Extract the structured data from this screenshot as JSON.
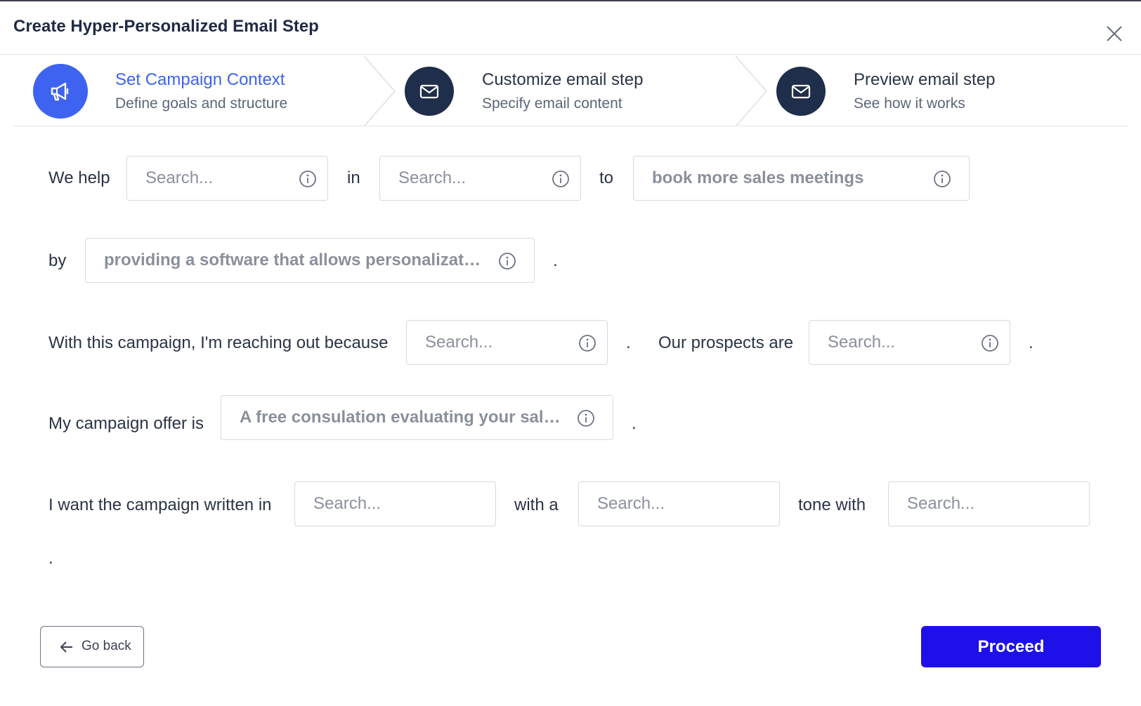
{
  "modal": {
    "title": "Create Hyper-Personalized Email Step"
  },
  "steps": [
    {
      "title": "Set Campaign Context",
      "subtitle": "Define goals and structure",
      "icon": "megaphone-icon",
      "color": "#3e63f0",
      "active": true
    },
    {
      "title": "Customize email step",
      "subtitle": "Specify email content",
      "icon": "envelope-icon",
      "color": "#1f2e4a",
      "active": false
    },
    {
      "title": "Preview email step",
      "subtitle": "See how it works",
      "icon": "envelope-icon",
      "color": "#1f2e4a",
      "active": false
    }
  ],
  "form": {
    "row1": {
      "we_help": "We help",
      "in": "in",
      "to": "to",
      "who_placeholder": "Search...",
      "industry_placeholder": "Search...",
      "goal_value": "book more sales meetings"
    },
    "row2": {
      "by": "by",
      "method_value": "providing a software that allows personalizati…",
      "period": "."
    },
    "row3": {
      "reaching_out": "With this campaign, I'm reaching out because",
      "reason_placeholder": "Search...",
      "period1": ".",
      "prospects_are": "Our prospects are",
      "prospects_placeholder": "Search...",
      "period2": "."
    },
    "row4": {
      "offer_is": "My campaign offer is",
      "offer_value": "A free consulation evaluating your sale…",
      "period": "."
    },
    "row5": {
      "written_in": "I want the campaign written in",
      "language_placeholder": "Search...",
      "with_a": "with a",
      "tone_placeholder": "Search...",
      "tone_with": "tone with",
      "style_placeholder": "Search...",
      "period": "."
    }
  },
  "footer": {
    "back_label": "Go back",
    "proceed_label": "Proceed"
  },
  "colors": {
    "accent": "#3e63f0",
    "primary_button": "#1e10e8",
    "dark_step": "#1f2e4a"
  }
}
